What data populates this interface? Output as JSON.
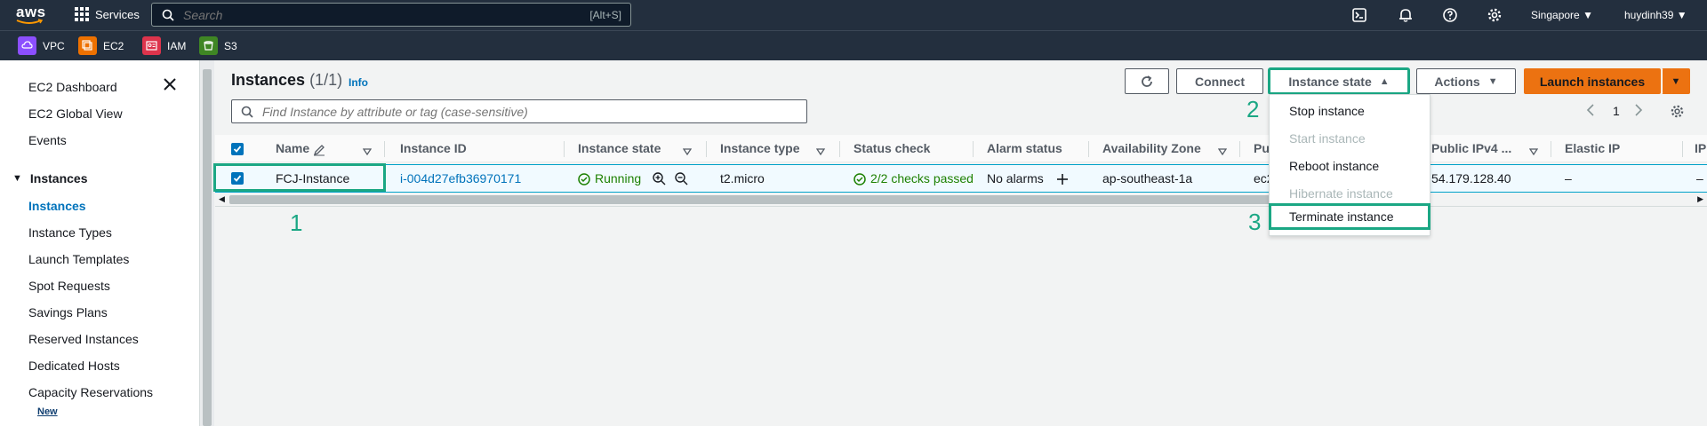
{
  "topnav": {
    "logo_text": "aws",
    "services_label": "Services",
    "search_placeholder": "Search",
    "search_shortcut": "[Alt+S]",
    "region": "Singapore",
    "user": "huydinh39"
  },
  "favorites": [
    {
      "label": "VPC",
      "color": "#8c4fff"
    },
    {
      "label": "EC2",
      "color": "#ed7100"
    },
    {
      "label": "IAM",
      "color": "#dd344c"
    },
    {
      "label": "S3",
      "color": "#3f8624"
    }
  ],
  "sidebar": {
    "top_items": [
      "EC2 Dashboard",
      "EC2 Global View",
      "Events"
    ],
    "section": "Instances",
    "items": [
      "Instances",
      "Instance Types",
      "Launch Templates",
      "Spot Requests",
      "Savings Plans",
      "Reserved Instances",
      "Dedicated Hosts",
      "Capacity Reservations"
    ],
    "new_badge": "New"
  },
  "main": {
    "title": "Instances",
    "count": "(1/1)",
    "info": "Info",
    "search_placeholder": "Find Instance by attribute or tag (case-sensitive)",
    "page": "1",
    "buttons": {
      "connect": "Connect",
      "instance_state": "Instance state",
      "actions": "Actions",
      "launch": "Launch instances"
    }
  },
  "table": {
    "columns": [
      "Name",
      "Instance ID",
      "Instance state",
      "Instance type",
      "Status check",
      "Alarm status",
      "Availability Zone",
      "Pu",
      "Public IPv4 ...",
      "Elastic IP",
      "IP"
    ],
    "row": {
      "name": "FCJ-Instance",
      "instance_id": "i-004d27efb36970171",
      "state": "Running",
      "type": "t2.micro",
      "status_check": "2/2 checks passed",
      "alarm": "No alarms",
      "az": "ap-southeast-1a",
      "public_dns": "ec2",
      "ipv4": "54.179.128.40",
      "elastic_ip": "–",
      "ipv6": "–"
    }
  },
  "dropdown": {
    "items": [
      {
        "label": "Stop instance",
        "enabled": true
      },
      {
        "label": "Start instance",
        "enabled": false
      },
      {
        "label": "Reboot instance",
        "enabled": true
      },
      {
        "label": "Hibernate instance",
        "enabled": false
      },
      {
        "label": "Terminate instance",
        "enabled": true
      }
    ]
  },
  "annotations": {
    "step1": "1",
    "step2": "2",
    "step3": "3"
  },
  "colors": {
    "highlight": "#1ba784",
    "accent": "#ec7211",
    "link": "#0073bb",
    "nav": "#232f3e"
  }
}
